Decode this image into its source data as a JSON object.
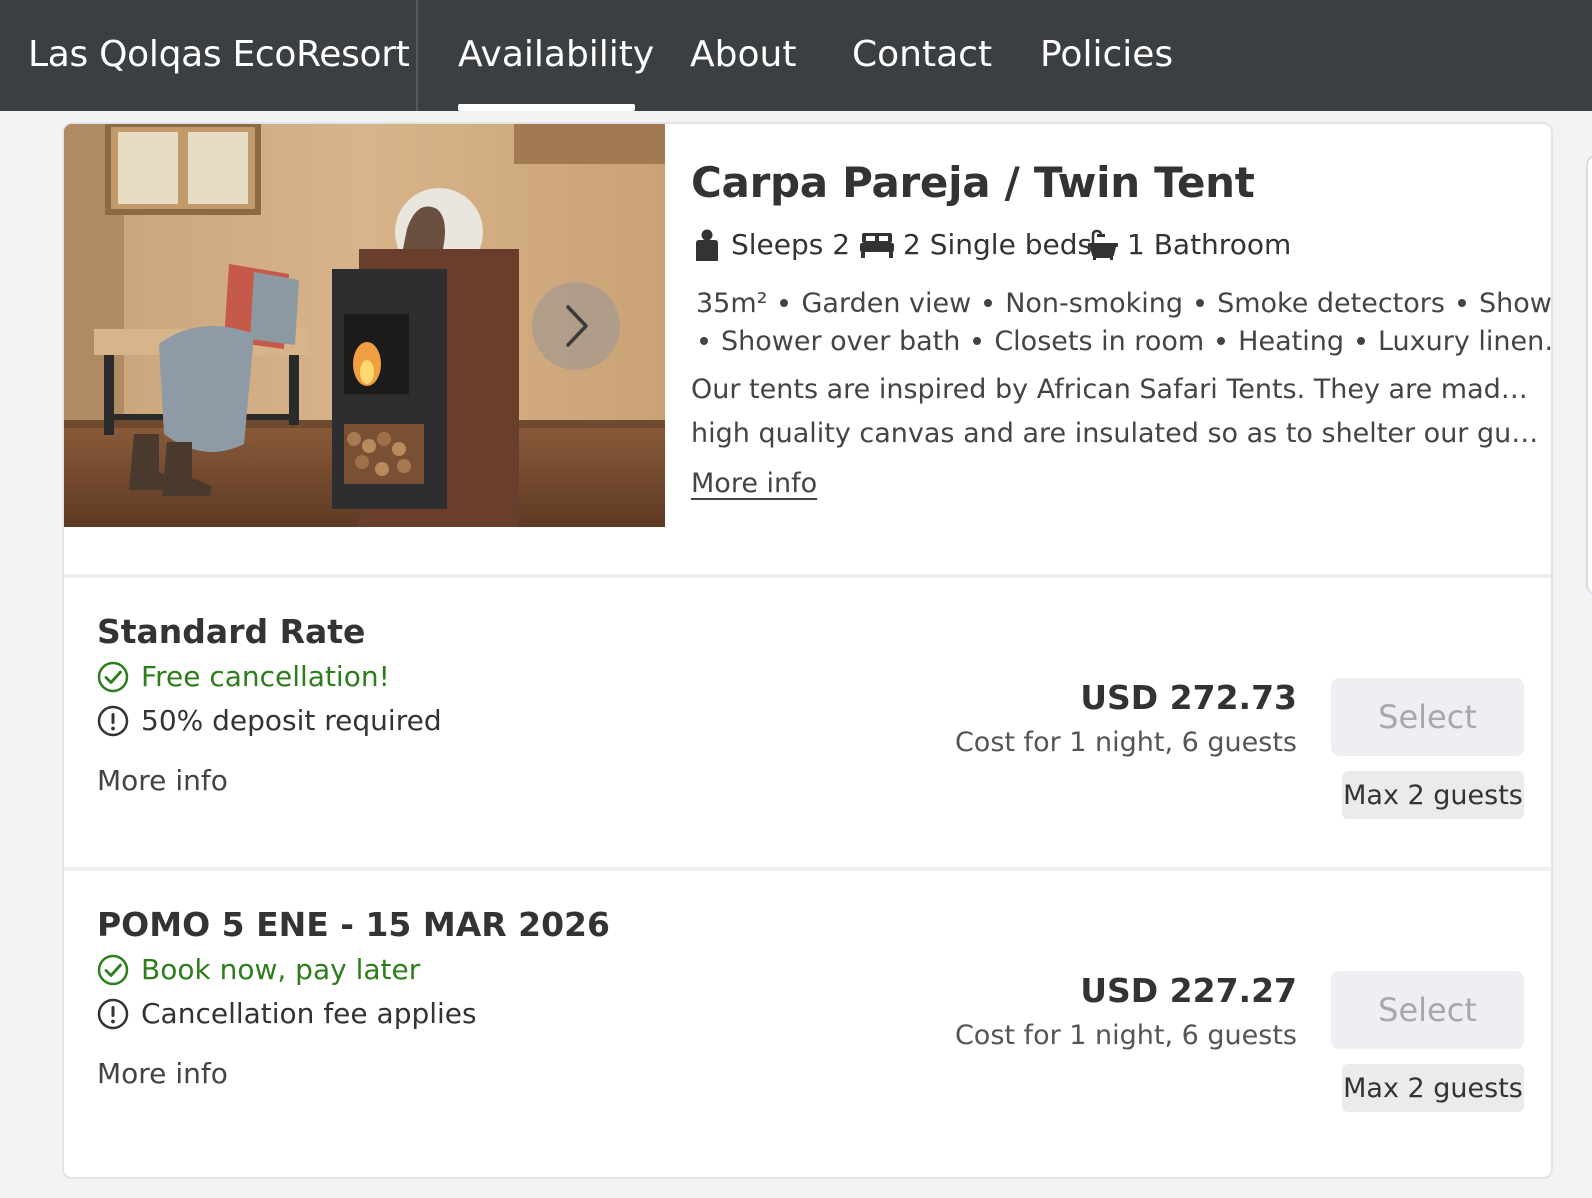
{
  "nav": {
    "brand": "Las Qolqas EcoResort",
    "items": [
      {
        "label": "Availability",
        "active": true
      },
      {
        "label": "About"
      },
      {
        "label": "Contact"
      },
      {
        "label": "Policies"
      }
    ]
  },
  "room": {
    "title": "Carpa Pareja / Twin Tent",
    "facts": [
      {
        "icon": "person-icon",
        "label": "Sleeps 2"
      },
      {
        "icon": "bed-icon",
        "label": "2 Single beds"
      },
      {
        "icon": "bathtub-icon",
        "label": "1 Bathroom"
      }
    ],
    "amenities_line1": [
      "35m²",
      "Garden view",
      "Non-smoking",
      "Smoke detectors",
      "Shower"
    ],
    "amenities_line2": [
      "Shower over bath",
      "Closets in room",
      "Heating",
      "Luxury linen…"
    ],
    "description_line1": "Our tents are inspired by African Safari Tents. They are made of very",
    "description_line2": "high quality canvas and are insulated so as to shelter our guests fro…",
    "more_info": "More info"
  },
  "rates": [
    {
      "name": "Standard Rate",
      "positive": "Free cancellation!",
      "notice": "50% deposit required",
      "more_info": "More info",
      "price": "USD 272.73",
      "price_note": "Cost for 1 night, 6 guests",
      "select_label": "Select",
      "max_guests": "Max 2 guests"
    },
    {
      "name": "POMO 5 ENE - 15 MAR 2026",
      "positive": "Book now, pay later",
      "notice": "Cancellation fee applies",
      "more_info": "More info",
      "price": "USD 227.27",
      "price_note": "Cost for 1 night, 6 guests",
      "select_label": "Select",
      "max_guests": "Max 2 guests"
    }
  ],
  "colors": {
    "nav_bg": "#3b3f42",
    "positive_green": "#2e7d1c",
    "select_disabled_bg": "#efeff3",
    "select_disabled_text": "#a6a8ae"
  }
}
